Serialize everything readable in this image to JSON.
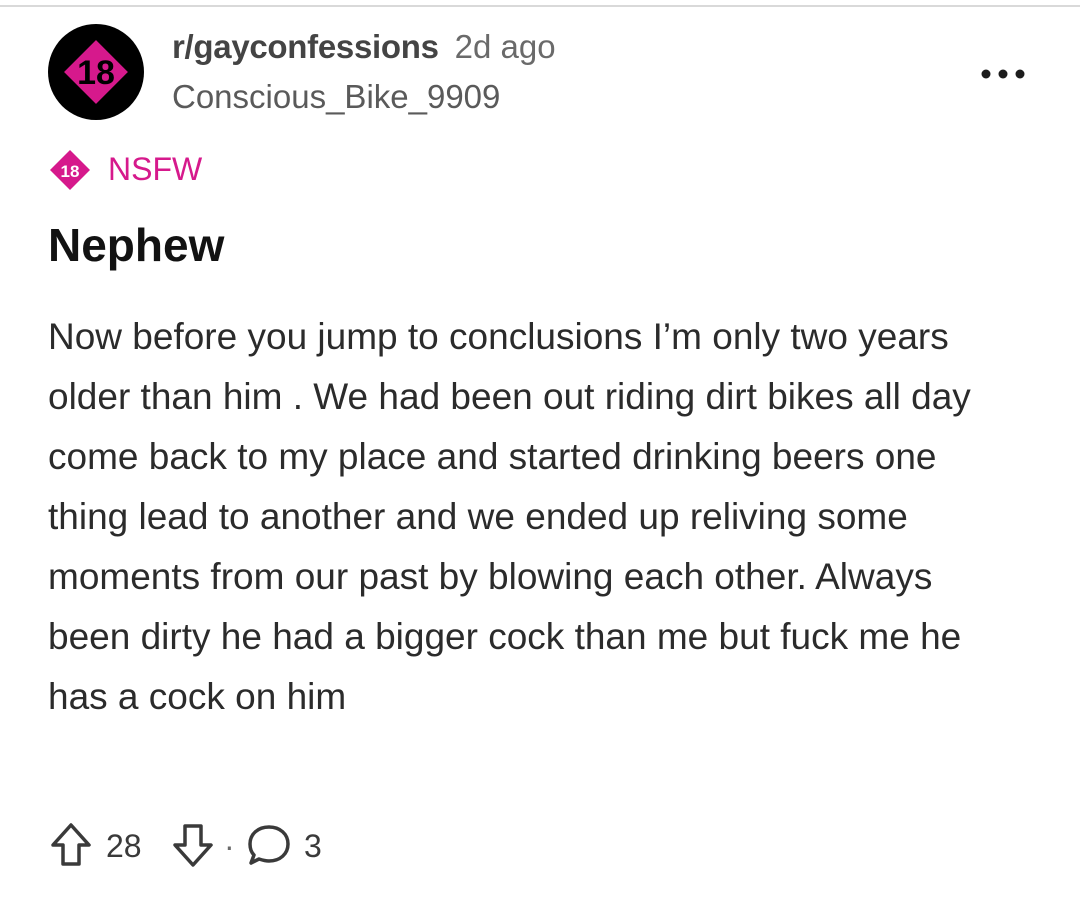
{
  "post": {
    "avatar_badge": "18",
    "subreddit": "r/gayconfessions",
    "time_ago": "2d ago",
    "author": "Conscious_Bike_9909",
    "nsfw_badge_number": "18",
    "nsfw_label": "NSFW",
    "title": "Nephew",
    "body": "Now before you jump to conclusions I’m only two years older than him . We had been out riding dirt bikes all day come back to my place and started drinking beers one thing lead to another and we ended up reliving some moments from our past by blowing each other. Always been dirty he had a bigger cock than me but fuck me he has a cock on him"
  },
  "actions": {
    "upvote_icon": "arrow-up-icon",
    "score": "28",
    "downvote_icon": "arrow-down-icon",
    "separator": "·",
    "comment_icon": "comment-bubble-icon",
    "comments": "3"
  },
  "menu": {
    "more_icon": "ellipsis-icon"
  },
  "colors": {
    "nsfw_accent": "#d6198c",
    "avatar_bg": "#000000",
    "text_primary": "#121212",
    "text_secondary": "#5a5a5a"
  }
}
